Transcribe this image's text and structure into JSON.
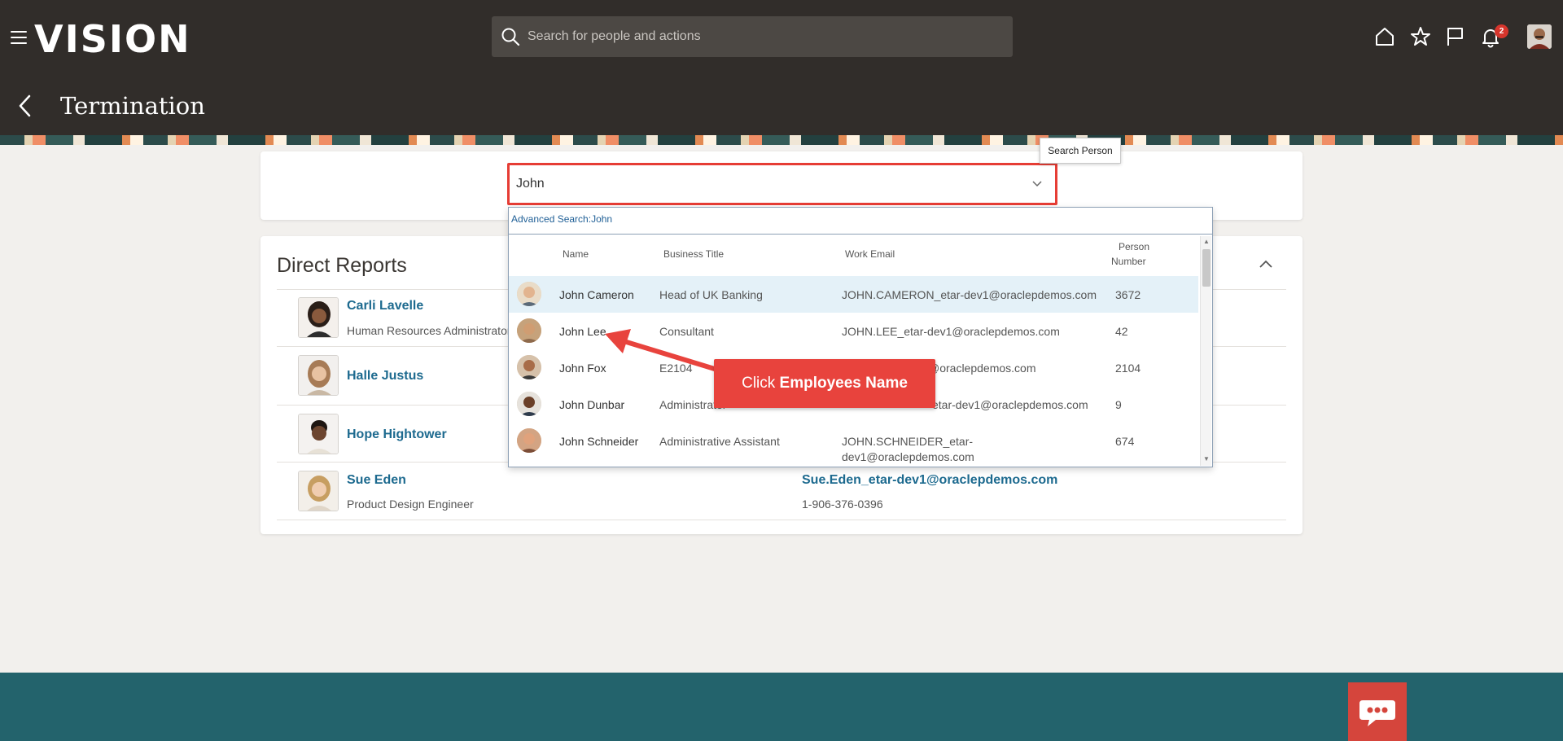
{
  "header": {
    "logo": "VISION",
    "search_placeholder": "Search for people and actions",
    "notification_count": "2",
    "icons": [
      "menu-icon",
      "search-icon",
      "home-icon",
      "star-icon",
      "flag-icon",
      "bell-icon",
      "user-avatar"
    ]
  },
  "page": {
    "title": "Termination"
  },
  "person_search": {
    "value": "John",
    "tooltip": "Search Person"
  },
  "dropdown": {
    "advanced_search": "Advanced Search:John",
    "headers": {
      "name": "Name",
      "business_title": "Business Title",
      "work_email": "Work Email",
      "person_number_line1": "Person",
      "person_number_line2": "Number"
    },
    "rows": [
      {
        "name": "John Cameron",
        "title": "Head of UK Banking",
        "email": "JOHN.CAMERON_etar-dev1@oraclepdemos.com",
        "email2": "",
        "number": "3672"
      },
      {
        "name": "John Lee",
        "title": "Consultant",
        "email": "JOHN.LEE_etar-dev1@oraclepdemos.com",
        "email2": "",
        "number": "42"
      },
      {
        "name": "John Fox",
        "title": "E2104",
        "email": "@oraclepdemos.com",
        "email2": "",
        "number": "2104"
      },
      {
        "name": "John Dunbar",
        "title": "Administrator",
        "email": "etar-dev1@oraclepdemos.com",
        "email2": "",
        "number": "9"
      },
      {
        "name": "John Schneider",
        "title": "Administrative Assistant",
        "email": "JOHN.SCHNEIDER_etar-",
        "email2": "dev1@oraclepdemos.com",
        "number": "674"
      }
    ]
  },
  "callout": {
    "prefix": "Click",
    "bold": "Employees Name"
  },
  "direct_reports": {
    "title": "Direct Reports",
    "items": [
      {
        "name": "Carli Lavelle",
        "title": "Human Resources Administrator",
        "email": "",
        "phone": ""
      },
      {
        "name": "Halle Justus",
        "title": "",
        "email": "",
        "phone": ""
      },
      {
        "name": "Hope Hightower",
        "title": "",
        "email": "",
        "phone": ""
      },
      {
        "name": "Sue Eden",
        "title": "Product Design Engineer",
        "email": "Sue.Eden_etar-dev1@oraclepdemos.com",
        "phone": "1-906-376-0396"
      }
    ]
  },
  "colors": {
    "header_bg": "#312d2a",
    "accent_red": "#e63d35",
    "link_blue": "#1d6a8f",
    "footer_teal": "#23636c",
    "selected_row": "#e4f1f8"
  }
}
